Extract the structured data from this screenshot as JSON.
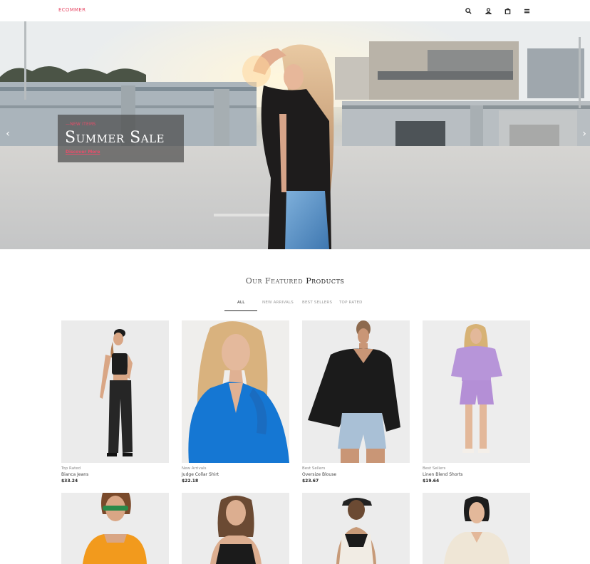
{
  "header": {
    "logo": "ECOMMER",
    "icons": [
      "search-icon",
      "user-icon",
      "bag-icon",
      "menu-icon"
    ]
  },
  "hero": {
    "kicker": "—NEW ITEMS",
    "title": "Summer Sale",
    "link": "Discover More",
    "prev_icon": "chevron-left-icon",
    "next_icon": "chevron-right-icon"
  },
  "featured": {
    "title_prefix": "Our Featured",
    "title_bold": "Products",
    "tabs": [
      {
        "label": "ALL",
        "active": true
      },
      {
        "label": "NEW ARRIVALS",
        "active": false
      },
      {
        "label": "BEST SELLERS",
        "active": false
      },
      {
        "label": "TOP RATED",
        "active": false
      }
    ],
    "products": [
      {
        "category": "Top Rated",
        "name": "Bianca Jeans",
        "price": "$33.24"
      },
      {
        "category": "New Arrivals",
        "name": "Judge Collar Shirt",
        "price": "$22.18"
      },
      {
        "category": "Best Sellers",
        "name": "Oversize Blouse",
        "price": "$23.67"
      },
      {
        "category": "Best Sellers",
        "name": "Linen Blend Shorts",
        "price": "$19.64"
      }
    ]
  },
  "colors": {
    "accent": "#e84e6a",
    "text_dark": "#222222",
    "text_muted": "#888888",
    "promo_bg": "#464646"
  }
}
